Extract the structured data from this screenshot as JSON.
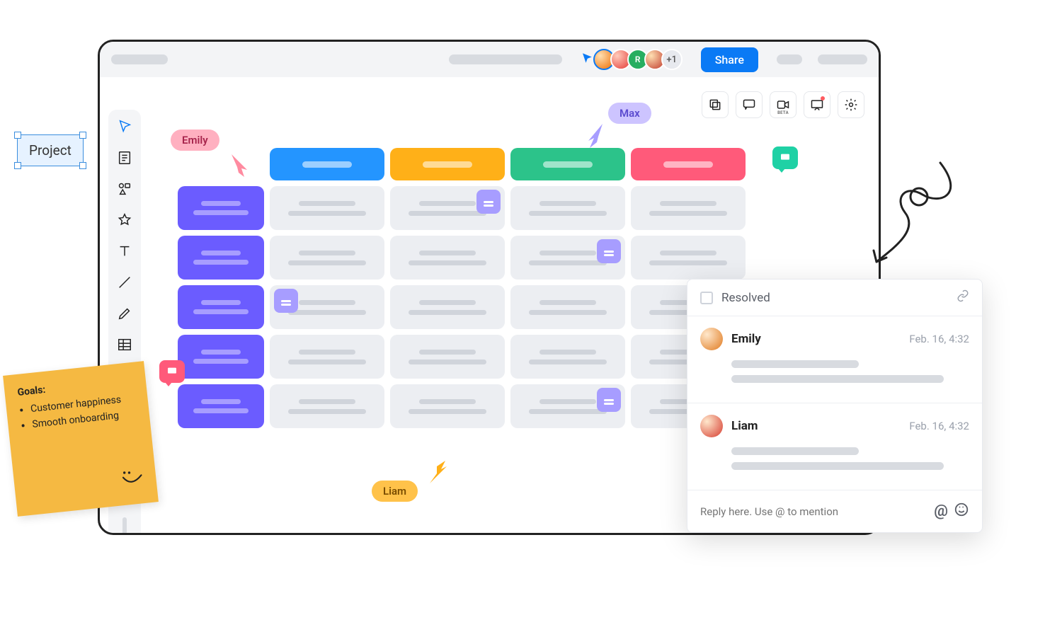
{
  "header": {
    "share_label": "Share",
    "more_count": "+1"
  },
  "cursors": {
    "emily": "Emily",
    "max": "Max",
    "liam": "Liam"
  },
  "project_box": {
    "label": "Project"
  },
  "sticky": {
    "title": "Goals:",
    "items": [
      "Customer happiness",
      "Smooth onboarding"
    ]
  },
  "comments": {
    "resolved_label": "Resolved",
    "items": [
      {
        "author": "Emily",
        "timestamp": "Feb. 16, 4:32"
      },
      {
        "author": "Liam",
        "timestamp": "Feb. 16, 4:32"
      }
    ],
    "reply_placeholder": "Reply here. Use @ to mention"
  },
  "toolbelt": {
    "video_badge": "BETA"
  }
}
